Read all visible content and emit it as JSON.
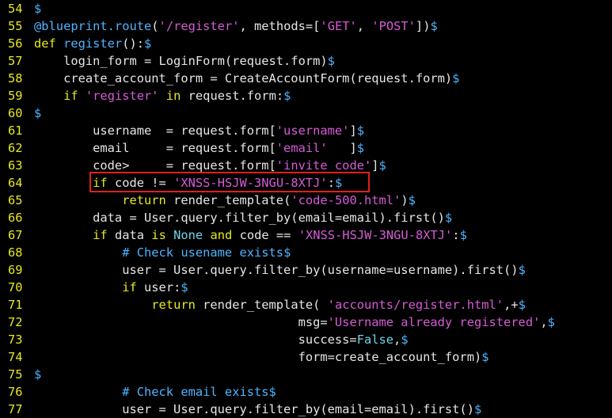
{
  "editor": {
    "highlight_color": "#e0201c",
    "colors": {
      "background": "#000000",
      "line_number": "#e8e820",
      "keyword": "#e8e820",
      "string": "#d65bd6",
      "decorator": "#4fb4ff",
      "constant": "#6fd3e8",
      "plain": "#e6e6e6"
    },
    "lines": [
      {
        "num": "54",
        "tokens": [
          [
            "eol",
            "$"
          ]
        ]
      },
      {
        "num": "55",
        "tokens": [
          [
            "deco",
            "@blueprint.route"
          ],
          [
            "plain",
            "("
          ],
          [
            "str",
            "'/register'"
          ],
          [
            "plain",
            ", methods=["
          ],
          [
            "str",
            "'GET'"
          ],
          [
            "plain",
            ", "
          ],
          [
            "str",
            "'POST'"
          ],
          [
            "plain",
            "])"
          ],
          [
            "eol",
            "$"
          ]
        ]
      },
      {
        "num": "56",
        "tokens": [
          [
            "kw",
            "def "
          ],
          [
            "fn",
            "register"
          ],
          [
            "plain",
            "():"
          ],
          [
            "eol",
            "$"
          ]
        ]
      },
      {
        "num": "57",
        "tokens": [
          [
            "plain",
            "    login_form = LoginForm(request.form)"
          ],
          [
            "eol",
            "$"
          ]
        ]
      },
      {
        "num": "58",
        "tokens": [
          [
            "plain",
            "    create_account_form = CreateAccountForm(request.form)"
          ],
          [
            "eol",
            "$"
          ]
        ]
      },
      {
        "num": "59",
        "tokens": [
          [
            "plain",
            "    "
          ],
          [
            "kw",
            "if "
          ],
          [
            "str",
            "'register'"
          ],
          [
            "kw",
            " in"
          ],
          [
            "plain",
            " request.form:"
          ],
          [
            "eol",
            "$"
          ]
        ]
      },
      {
        "num": "60",
        "tokens": [
          [
            "eol",
            "$"
          ]
        ]
      },
      {
        "num": "61",
        "tokens": [
          [
            "plain",
            "        username  = request.form["
          ],
          [
            "str",
            "'username'"
          ],
          [
            "plain",
            "]"
          ],
          [
            "eol",
            "$"
          ]
        ]
      },
      {
        "num": "62",
        "tokens": [
          [
            "plain",
            "        email     = request.form["
          ],
          [
            "str",
            "'email'"
          ],
          [
            "plain",
            "   ]"
          ],
          [
            "eol",
            "$"
          ]
        ]
      },
      {
        "num": "63",
        "tokens": [
          [
            "plain",
            "        code>     = request.form["
          ],
          [
            "str",
            "'invite_code'"
          ],
          [
            "plain",
            "]"
          ],
          [
            "eol",
            "$"
          ]
        ]
      },
      {
        "num": "64",
        "tokens": [
          [
            "plain",
            "        "
          ],
          [
            "kw",
            "if"
          ],
          [
            "plain",
            " code != "
          ],
          [
            "str",
            "'XNSS-HSJW-3NGU-8XTJ'"
          ],
          [
            "plain",
            ":"
          ],
          [
            "eol",
            "$"
          ]
        ]
      },
      {
        "num": "65",
        "tokens": [
          [
            "plain",
            "            "
          ],
          [
            "kw",
            "return"
          ],
          [
            "plain",
            " render_template("
          ],
          [
            "str",
            "'code-500.html'"
          ],
          [
            "plain",
            ")"
          ],
          [
            "eol",
            "$"
          ]
        ]
      },
      {
        "num": "66",
        "tokens": [
          [
            "plain",
            "        data = User.query.filter_by(email=email).first()"
          ],
          [
            "eol",
            "$"
          ]
        ]
      },
      {
        "num": "67",
        "tokens": [
          [
            "plain",
            "        "
          ],
          [
            "kw",
            "if"
          ],
          [
            "plain",
            " data "
          ],
          [
            "kw",
            "is"
          ],
          [
            "plain",
            " "
          ],
          [
            "const",
            "None"
          ],
          [
            "plain",
            " "
          ],
          [
            "kw",
            "and"
          ],
          [
            "plain",
            " code == "
          ],
          [
            "str",
            "'XNSS-HSJW-3NGU-8XTJ'"
          ],
          [
            "plain",
            ":"
          ],
          [
            "eol",
            "$"
          ]
        ]
      },
      {
        "num": "68",
        "tokens": [
          [
            "plain",
            "            "
          ],
          [
            "cmt",
            "# Check usename exists"
          ],
          [
            "eol",
            "$"
          ]
        ]
      },
      {
        "num": "69",
        "tokens": [
          [
            "plain",
            "            user = User.query.filter_by(username=username).first()"
          ],
          [
            "eol",
            "$"
          ]
        ]
      },
      {
        "num": "70",
        "tokens": [
          [
            "plain",
            "            "
          ],
          [
            "kw",
            "if"
          ],
          [
            "plain",
            " user:"
          ],
          [
            "eol",
            "$"
          ]
        ]
      },
      {
        "num": "71",
        "tokens": [
          [
            "plain",
            "                "
          ],
          [
            "kw",
            "return"
          ],
          [
            "plain",
            " render_template( "
          ],
          [
            "str",
            "'accounts/register.html'"
          ],
          [
            "plain",
            ",+"
          ],
          [
            "eol",
            "$"
          ]
        ]
      },
      {
        "num": "72",
        "tokens": [
          [
            "plain",
            "                                    msg="
          ],
          [
            "str",
            "'Username already registered'"
          ],
          [
            "plain",
            ","
          ],
          [
            "eol",
            "$"
          ]
        ]
      },
      {
        "num": "73",
        "tokens": [
          [
            "plain",
            "                                    success="
          ],
          [
            "const",
            "False"
          ],
          [
            "plain",
            ","
          ],
          [
            "eol",
            "$"
          ]
        ]
      },
      {
        "num": "74",
        "tokens": [
          [
            "plain",
            "                                    form=create_account_form)"
          ],
          [
            "eol",
            "$"
          ]
        ]
      },
      {
        "num": "75",
        "tokens": [
          [
            "eol",
            "$"
          ]
        ]
      },
      {
        "num": "76",
        "tokens": [
          [
            "plain",
            "            "
          ],
          [
            "cmt",
            "# Check email exists"
          ],
          [
            "eol",
            "$"
          ]
        ]
      },
      {
        "num": "77",
        "tokens": [
          [
            "plain",
            "            user = User.query.filter_by(email=email).first()"
          ],
          [
            "eol",
            "$"
          ]
        ]
      }
    ]
  }
}
